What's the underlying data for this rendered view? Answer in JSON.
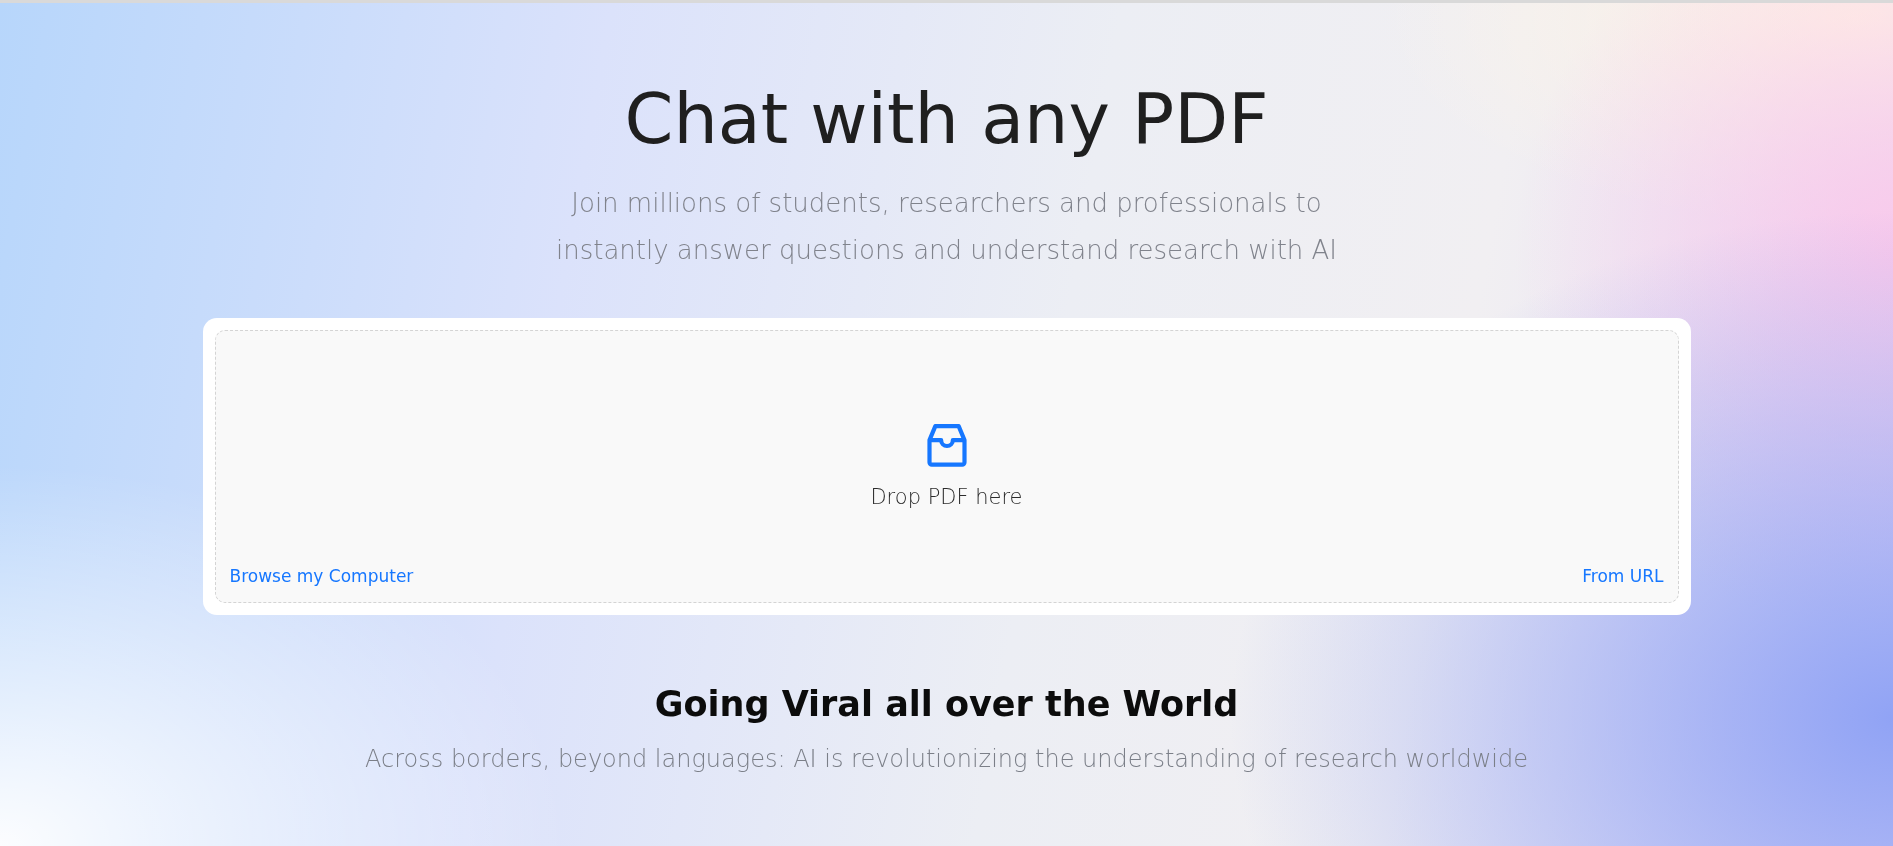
{
  "hero": {
    "title": "Chat with any PDF",
    "subtitle_lines": [
      "Join millions of students, researchers and professionals to",
      "instantly answer questions and understand research with AI"
    ]
  },
  "upload": {
    "prompt": "Drop PDF here",
    "browse_link": "Browse my Computer",
    "url_link": "From URL"
  },
  "section": {
    "title": "Going Viral all over the World",
    "subtitle": "Across borders, beyond languages: AI is revolutionizing the understanding of research worldwide"
  }
}
